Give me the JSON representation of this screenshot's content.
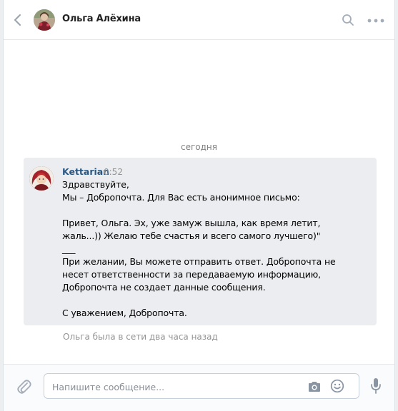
{
  "header": {
    "contact_name": "Ольга Алёхина",
    "back_icon": "chevron-left-icon",
    "search_icon": "search-icon",
    "more_icon": "more-dots-icon"
  },
  "chat": {
    "date_divider": "сегодня",
    "messages": [
      {
        "author": "Kettarian",
        "time": "0:52",
        "text": "Здравствуйте,\nМы – Добропочта. Для Вас есть анонимное письмо:\n\nПривет, Ольга. Эх, уже замуж вышла, как время летит,\nжаль...)) Желаю тебе счастья и всего самого лучшего)\"\n___\nПри желании, Вы можете отправить ответ. Добропочта не\nнесет ответственности за передаваемую информацию,\nДобропочта не создает данные сообщения.\n\nС уважением, Добропочта."
      }
    ],
    "status": "Ольга была в сети два часа назад"
  },
  "composer": {
    "placeholder": "Напишите сообщение...",
    "value": "",
    "attach_icon": "paperclip-icon",
    "camera_icon": "camera-icon",
    "emoji_icon": "smiley-icon",
    "mic_icon": "microphone-icon"
  },
  "colors": {
    "link": "#2a5885",
    "message_bg": "#ebedf0",
    "icon": "#aab4c0",
    "muted": "#939393"
  }
}
